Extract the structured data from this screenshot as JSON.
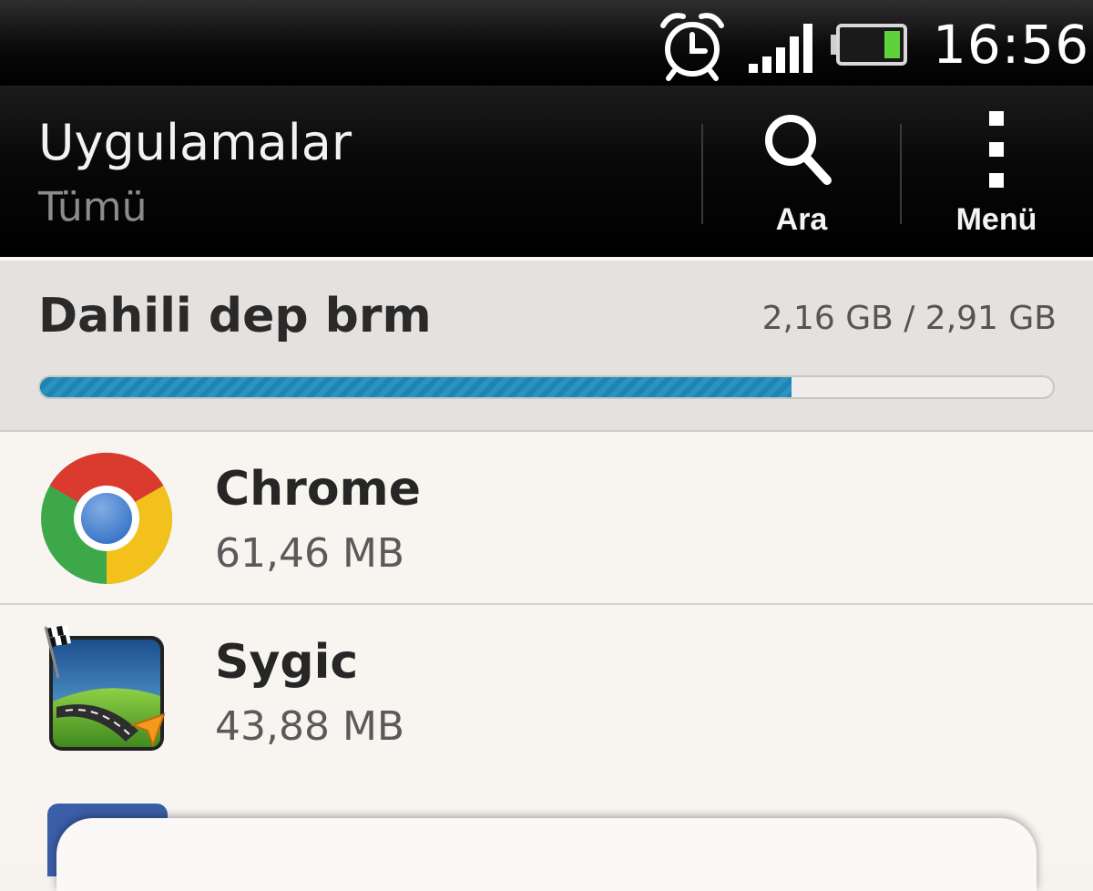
{
  "status_bar": {
    "alarm_icon": "alarm-clock-icon",
    "signal_icon": "cell-signal-icon",
    "battery_icon": "battery-icon",
    "battery_level": 0.25,
    "time": "16:56"
  },
  "action_bar": {
    "title": "Uygulamalar",
    "subtitle": "Tümü",
    "search": {
      "label": "Ara",
      "icon": "search-icon"
    },
    "menu": {
      "label": "Menü",
      "icon": "overflow-menu-icon"
    }
  },
  "storage": {
    "title": "Dahili dep brm",
    "usage": "2,16 GB / 2,91 GB",
    "used_fraction": 0.742,
    "bar_color": "#2b93c2"
  },
  "apps": [
    {
      "name": "Chrome",
      "size": "61,46 MB",
      "icon": "chrome-icon"
    },
    {
      "name": "Sygic",
      "size": "43,88 MB",
      "icon": "sygic-icon"
    }
  ],
  "partial_app": {
    "icon": "facebook-icon"
  }
}
